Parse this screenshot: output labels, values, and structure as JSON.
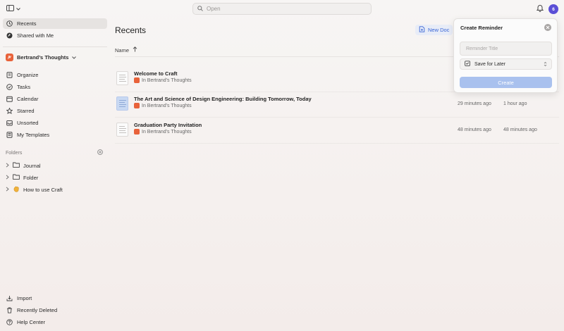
{
  "topbar": {
    "search_placeholder": "Open",
    "avatar_initial": "6"
  },
  "sidebar": {
    "nav_top": [
      {
        "label": "Recents",
        "icon": "clock-icon",
        "active": true
      },
      {
        "label": "Shared with Me",
        "icon": "shared-icon",
        "active": false
      }
    ],
    "space": {
      "name": "Bertrand’s Thoughts"
    },
    "nav_main": [
      {
        "label": "Organize",
        "icon": "organize-icon"
      },
      {
        "label": "Tasks",
        "icon": "tasks-icon"
      },
      {
        "label": "Calendar",
        "icon": "calendar-icon"
      },
      {
        "label": "Starred",
        "icon": "star-icon"
      },
      {
        "label": "Unsorted",
        "icon": "inbox-icon"
      },
      {
        "label": "My Templates",
        "icon": "template-icon"
      }
    ],
    "folders_heading": "Folders",
    "folders": [
      {
        "label": "Journal",
        "icon": "folder-icon"
      },
      {
        "label": "Folder",
        "icon": "folder-icon"
      },
      {
        "label": "How to use Craft",
        "icon": "hand-wave-icon"
      }
    ],
    "nav_bottom": [
      {
        "label": "Import",
        "icon": "import-icon"
      },
      {
        "label": "Recently Deleted",
        "icon": "trash-icon"
      },
      {
        "label": "Help Center",
        "icon": "help-icon"
      }
    ]
  },
  "main": {
    "title": "Recents",
    "new_doc_label": "New Doc",
    "sort_label": "Name",
    "documents": [
      {
        "title": "Welcome to Craft",
        "location": "In Bertrand’s Thoughts",
        "col1": "",
        "col2": "",
        "thumb": "plain"
      },
      {
        "title": "The Art and Science of Design Engineering: Building Tomorrow, Today",
        "location": "In Bertrand’s Thoughts",
        "col1": "29 minutes ago",
        "col2": "1 hour ago",
        "thumb": "blue"
      },
      {
        "title": "Graduation Party Invitation",
        "location": "In Bertrand’s Thoughts",
        "col1": "48 minutes ago",
        "col2": "48 minutes ago",
        "thumb": "plain"
      }
    ]
  },
  "reminder": {
    "title": "Create Reminder",
    "input_placeholder": "Reminder Title",
    "list_value": "Save for Later",
    "create_label": "Create"
  },
  "colors": {
    "accent": "#3a66d6",
    "space_logo": "#e8623a",
    "avatar": "#5b4fd6",
    "create_button": "#a9c1ee"
  }
}
